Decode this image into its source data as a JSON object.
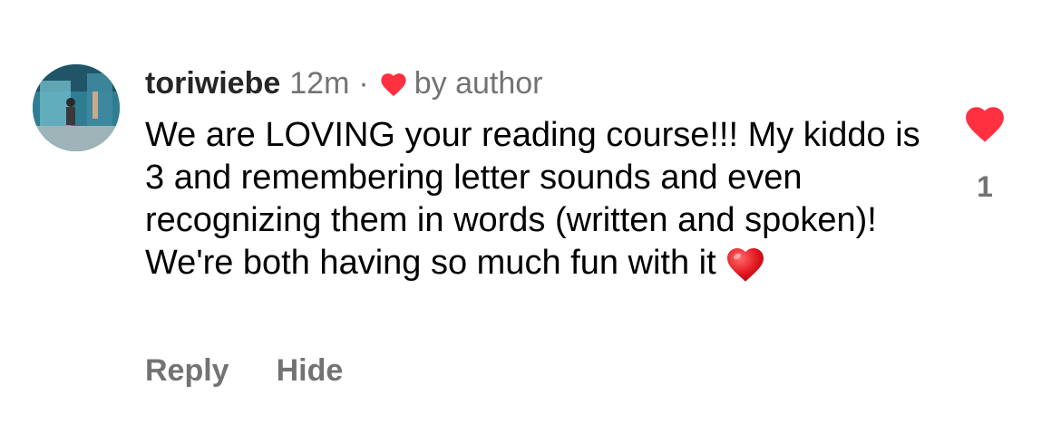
{
  "comment": {
    "username": "toriwiebe",
    "time": "12m",
    "separator": "·",
    "author_label": "by author",
    "author_heart_icon": "heart-icon",
    "text": "We are LOVING your reading course!!! My kiddo is 3 and remembering letter sounds and even recognizing them in words (written and spoken)! We're both having so much fun with it",
    "emoji_icon": "red-heart-emoji-icon",
    "like_count": "1",
    "like_icon": "heart-filled-icon"
  },
  "actions": {
    "reply_label": "Reply",
    "hide_label": "Hide"
  },
  "colors": {
    "heart_red": "#ff3040",
    "meta_gray": "#737373",
    "username": "#262626",
    "text": "#000000"
  }
}
